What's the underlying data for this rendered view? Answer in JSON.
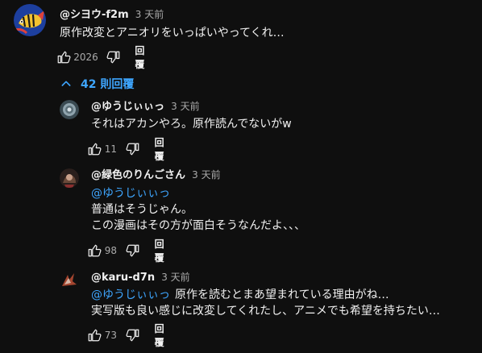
{
  "top_comment": {
    "author": "@シヨウ-f2m",
    "time": "3 天前",
    "text": "原作改変とアニオリをいっぱいやってくれ…",
    "likes": "2026",
    "reply_label": "回覆"
  },
  "replies_toggle": {
    "label": "42 則回覆"
  },
  "replies": [
    {
      "author": "@ゆうじぃぃっ",
      "time": "3 天前",
      "mention": "",
      "lines": [
        "それはアカンやろ。原作読んでないがw"
      ],
      "likes": "11",
      "reply_label": "回覆"
    },
    {
      "author": "@緑色のりんごさん",
      "time": "3 天前",
      "mention": "@ゆうじぃぃっ",
      "lines": [
        "普通はそうじゃん。",
        "この漫画はその方が面白そうなんだよ、、、"
      ],
      "likes": "98",
      "reply_label": "回覆"
    },
    {
      "author": "@karu-d7n",
      "time": "3 天前",
      "mention": "@ゆうじぃぃっ",
      "lines": [
        "原作を読むとまあ望まれている理由がね…",
        "実写版も良い感じに改変してくれたし、アニメでも希望を持ちたい…"
      ],
      "likes": "73",
      "reply_label": "回覆"
    }
  ],
  "icons": {
    "like": "thumbs-up-icon",
    "dislike": "thumbs-down-icon",
    "collapse": "chevron-up-icon"
  },
  "colors": {
    "background": "#0f0f0f",
    "text": "#f1f1f1",
    "secondary": "#aaaaaa",
    "link": "#3ea6ff"
  }
}
